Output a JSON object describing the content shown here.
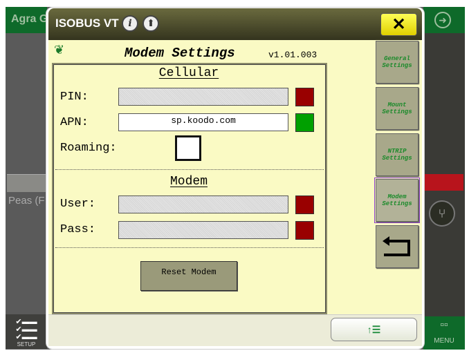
{
  "background": {
    "app_title": "Agra G",
    "crop_label": "Peas (F",
    "setup_label": "SETUP",
    "menu_label": "MENU"
  },
  "dialog": {
    "title": "ISOBUS VT",
    "close_symbol": "✕",
    "screen_title": "Modem Settings",
    "version": "v1.01.003",
    "cellular": {
      "heading": "Cellular",
      "pin_label": "PIN:",
      "pin_value": "",
      "pin_status_color": "#990000",
      "apn_label": "APN:",
      "apn_value": "sp.koodo.com",
      "apn_status_color": "#00a000",
      "roaming_label": "Roaming:",
      "roaming_checked": false
    },
    "modem": {
      "heading": "Modem",
      "user_label": "User:",
      "user_value": "",
      "user_status_color": "#990000",
      "pass_label": "Pass:",
      "pass_value": "",
      "pass_status_color": "#990000",
      "reset_label": "Reset Modem"
    },
    "side_nav": [
      {
        "label": "General Settings"
      },
      {
        "label": "Mount Settings"
      },
      {
        "label": "NTRIP Settings"
      },
      {
        "label": "Modem Settings",
        "active": true
      }
    ],
    "back_icon": "return-arrow-icon",
    "page_button_icon": "↑☰"
  }
}
